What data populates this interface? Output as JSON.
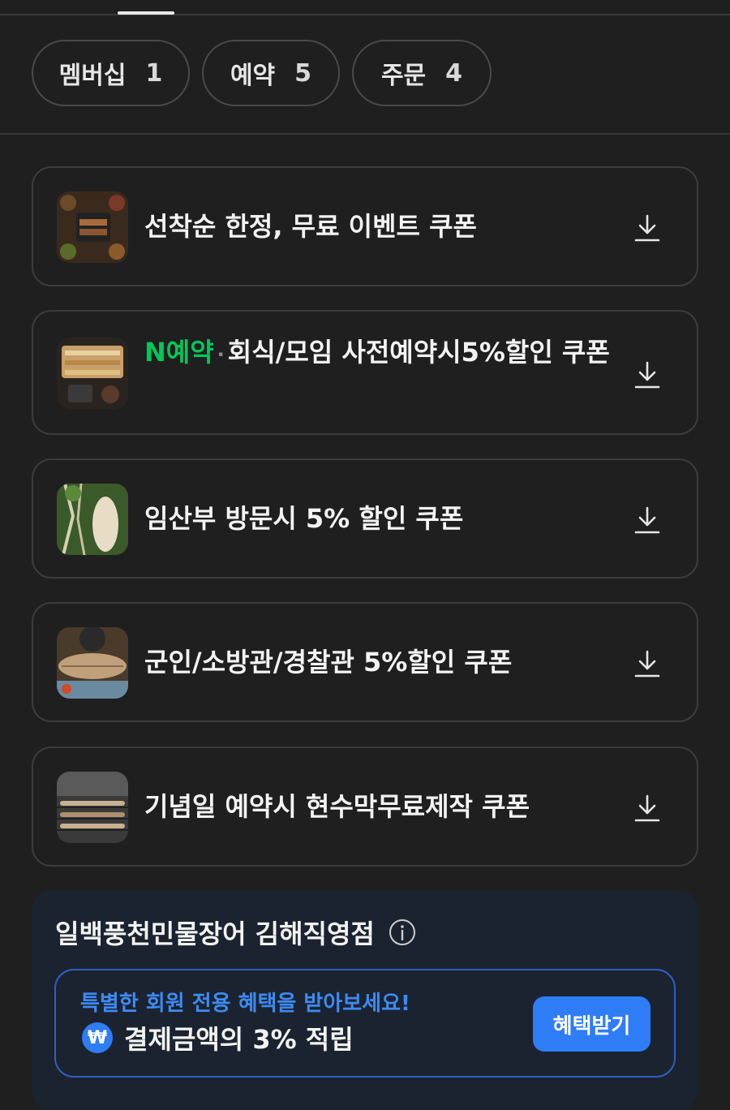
{
  "tabs": [
    {
      "label": "멤버십",
      "count": "1"
    },
    {
      "label": "예약",
      "count": "5"
    },
    {
      "label": "주문",
      "count": "4"
    }
  ],
  "coupons": [
    {
      "title": "선착순 한정, 무료 이벤트 쿠폰",
      "icon": "download-icon"
    },
    {
      "badge_n": "N",
      "badge_label": "예약",
      "separator": "·",
      "title": "회식/모임 사전예약시5%할인 쿠폰",
      "icon": "download-icon"
    },
    {
      "title": "임산부 방문시 5% 할인 쿠폰",
      "icon": "download-icon"
    },
    {
      "title": "군인/소방관/경찰관 5%할인 쿠폰",
      "icon": "download-icon"
    },
    {
      "title": "기념일 예약시 현수막무료제작 쿠폰",
      "icon": "download-icon"
    }
  ],
  "store": {
    "name": "일백풍천민물장어 김해직영점",
    "info_icon": "info-icon",
    "benefit": {
      "subtitle": "특별한 회원 전용 혜택을 받아보세요!",
      "currency_icon": "₩",
      "main": "결제금액의 3% 적립",
      "button": "혜택받기"
    }
  },
  "colors": {
    "background": "#1f1f1f",
    "naver_green": "#03c75a",
    "accent_blue": "#2e7cf6",
    "store_panel": "#1b2330"
  }
}
